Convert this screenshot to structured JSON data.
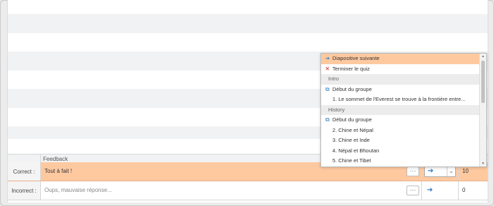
{
  "feedback_table": {
    "header_label": "Feedback",
    "rows": [
      {
        "name": "Correct :",
        "text": "Tout à fait !",
        "more": "···",
        "score": "10"
      },
      {
        "name": "Incorrect :",
        "text": "Oups, mauvaise réponse...",
        "more": "···",
        "score": "0"
      }
    ]
  },
  "action_select": {
    "arrow_icon": "arrow-right-icon",
    "chevron_icon": "chevron-down-icon"
  },
  "dropdown": {
    "items": [
      {
        "type": "action",
        "icon": "arrow-right-icon",
        "label": "Diapositive suivante",
        "selected": true
      },
      {
        "type": "action",
        "icon": "close-icon",
        "label": "Terminer le quiz"
      },
      {
        "type": "group",
        "label": "Intro"
      },
      {
        "type": "action",
        "icon": "group-icon",
        "label": "Début du groupe"
      },
      {
        "type": "question",
        "label": "1. Le sommet de l'Everest se trouve à la frontière entre..."
      },
      {
        "type": "group",
        "label": "History"
      },
      {
        "type": "action",
        "icon": "group-icon",
        "label": "Début du groupe"
      },
      {
        "type": "question",
        "label": "2. Chine et Népal"
      },
      {
        "type": "question",
        "label": "3. Chine et Inde"
      },
      {
        "type": "question",
        "label": "4. Népal et Bhoutan"
      },
      {
        "type": "question",
        "label": "5. Chine et Tibet"
      }
    ]
  },
  "colors": {
    "selected_row": "#ffc9a0",
    "accent": "#2f7bc4",
    "close": "#d9534f"
  }
}
